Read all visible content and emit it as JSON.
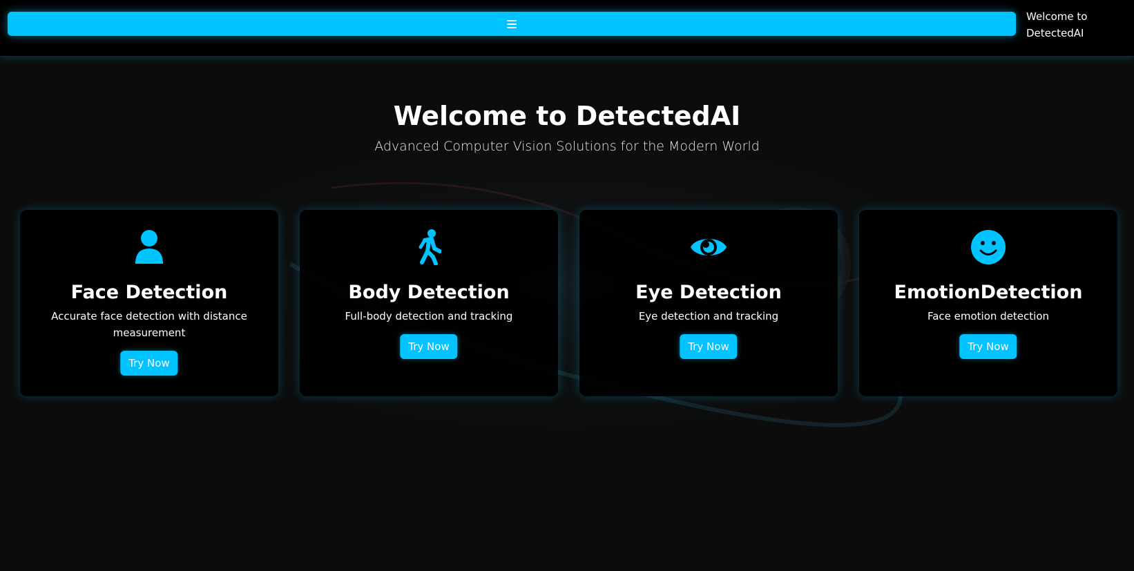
{
  "header": {
    "menu_icon": "hamburger-menu-icon",
    "brand_text": "Welcome to DetectedAI"
  },
  "hero": {
    "title": "Welcome to DetectedAI",
    "subtitle": "Advanced Computer Vision Solutions for the Modern World"
  },
  "cards": [
    {
      "icon": "person-icon",
      "title": "Face Detection",
      "description": "Accurate face detection with distance measurement",
      "button": "Try Now"
    },
    {
      "icon": "walking-person-icon",
      "title": "Body Detection",
      "description": "Full-body detection and tracking",
      "button": "Try Now"
    },
    {
      "icon": "eye-icon",
      "title": "Eye Detection",
      "description": "Eye detection and tracking",
      "button": "Try Now"
    },
    {
      "icon": "smiley-face-icon",
      "title": "EmotionDetection",
      "description": "Face emotion detection",
      "button": "Try Now"
    }
  ],
  "colors": {
    "accent": "#00c3ff",
    "background": "#0c0c0c",
    "card": "#000000",
    "text": "#ffffff"
  }
}
